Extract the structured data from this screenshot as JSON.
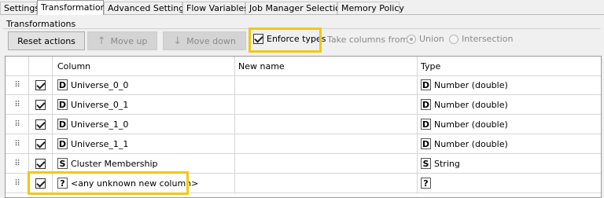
{
  "tabs": [
    "Settings",
    "Transformation",
    "Advanced Settings",
    "Flow Variables",
    "Job Manager Selection",
    "Memory Policy"
  ],
  "active_tab": "Transformation",
  "group_title": "Transformations",
  "toolbar": {
    "reset_label": "Reset actions",
    "move_up_label": "Move up",
    "move_down_label": "Move down",
    "enforce_types_label": "Enforce types",
    "enforce_types_checked": true,
    "take_columns_label": "Take columns from:",
    "union_label": "Union",
    "intersection_label": "Intersection",
    "selected_option": "Union"
  },
  "icons": {
    "up_arrow": "↑",
    "down_arrow": "↓",
    "grip": "⠿"
  },
  "highlight_color": "#f2c811",
  "table": {
    "columns": [
      "",
      "",
      "Column",
      "New name",
      "Type"
    ],
    "rows": [
      {
        "checked": true,
        "column_icon": "D",
        "column": "Universe_0_0",
        "new_name": "",
        "type_icon": "D",
        "type": "Number (double)"
      },
      {
        "checked": true,
        "column_icon": "D",
        "column": "Universe_0_1",
        "new_name": "",
        "type_icon": "D",
        "type": "Number (double)"
      },
      {
        "checked": true,
        "column_icon": "D",
        "column": "Universe_1_0",
        "new_name": "",
        "type_icon": "D",
        "type": "Number (double)"
      },
      {
        "checked": true,
        "column_icon": "D",
        "column": "Universe_1_1",
        "new_name": "",
        "type_icon": "D",
        "type": "Number (double)"
      },
      {
        "checked": true,
        "column_icon": "S",
        "column": "Cluster Membership",
        "new_name": "",
        "type_icon": "S",
        "type": "String"
      },
      {
        "checked": true,
        "column_icon": "?",
        "column": "<any unknown new column>",
        "new_name": "",
        "type_icon": "?",
        "type": ""
      }
    ]
  }
}
